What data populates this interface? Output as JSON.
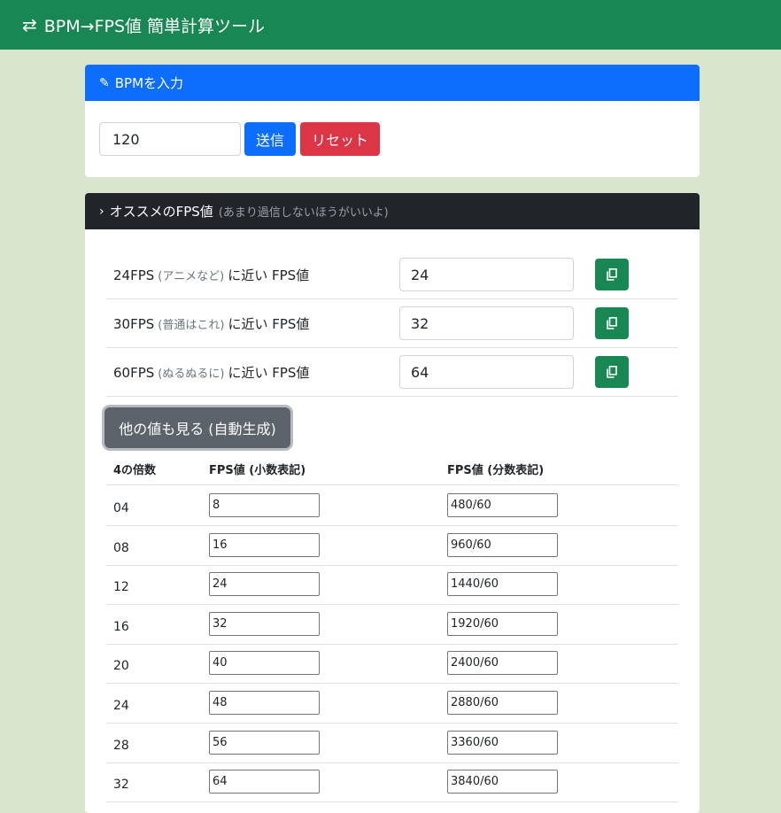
{
  "navbar": {
    "icon": "⇄",
    "title": "BPM→FPS値 簡単計算ツール"
  },
  "bpm_card": {
    "header_icon": "✎",
    "header": "BPMを入力",
    "input_value": "120",
    "send_label": "送信",
    "reset_label": "リセット"
  },
  "fps_card": {
    "header_icon": "›",
    "header": "オススメのFPS値",
    "hint": "(あまり過信しないほうがいいよ)",
    "rows": [
      {
        "fps": "24FPS",
        "note": "(アニメなど)",
        "suffix": "に近い FPS値",
        "value": "24"
      },
      {
        "fps": "30FPS",
        "note": "(普通はこれ)",
        "suffix": "に近い FPS値",
        "value": "32"
      },
      {
        "fps": "60FPS",
        "note": "(ぬるぬるに)",
        "suffix": "に近い FPS値",
        "value": "64"
      }
    ],
    "more_label": "他の値も見る (自動生成)",
    "table": {
      "headers": [
        "4の倍数",
        "FPS値 (小数表記)",
        "FPS値 (分数表記)"
      ],
      "rows": [
        [
          "04",
          "8",
          "480/60"
        ],
        [
          "08",
          "16",
          "960/60"
        ],
        [
          "12",
          "24",
          "1440/60"
        ],
        [
          "16",
          "32",
          "1920/60"
        ],
        [
          "20",
          "40",
          "2400/60"
        ],
        [
          "24",
          "48",
          "2880/60"
        ],
        [
          "28",
          "56",
          "3360/60"
        ],
        [
          "32",
          "64",
          "3840/60"
        ]
      ]
    }
  }
}
